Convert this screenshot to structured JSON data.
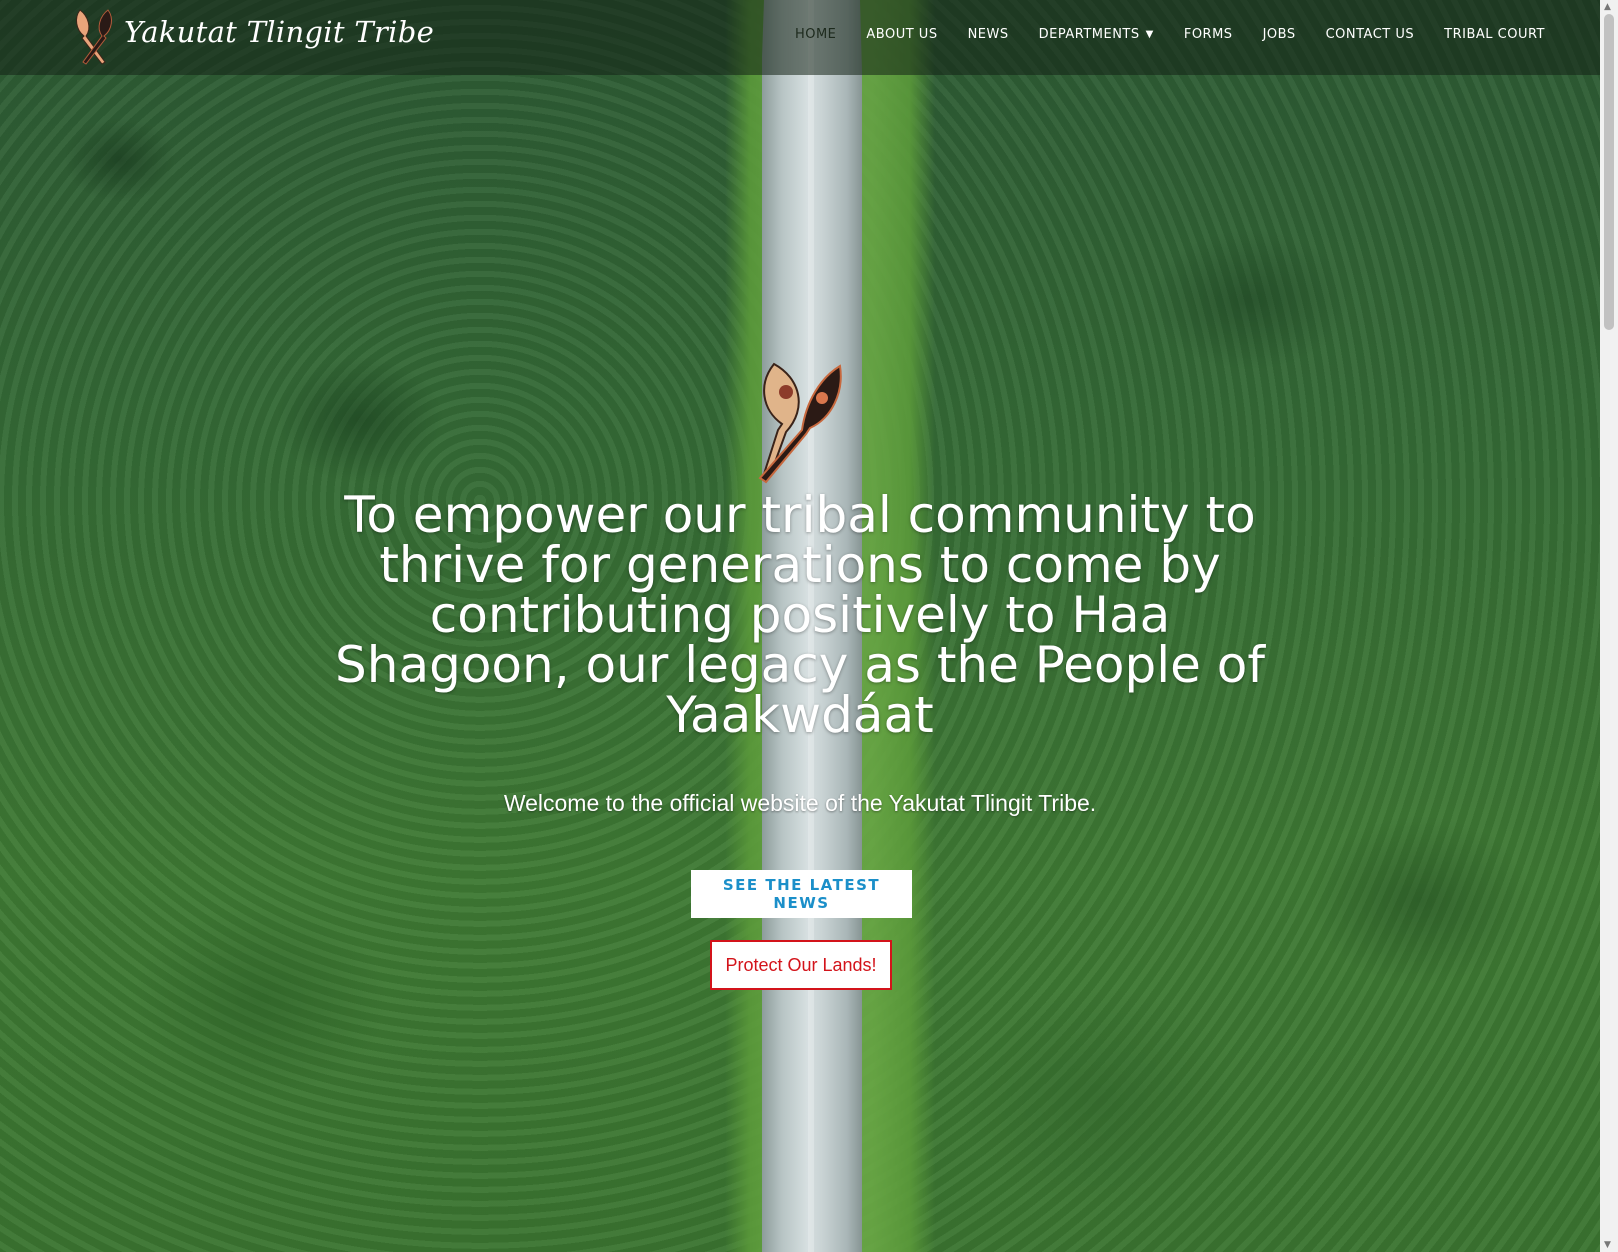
{
  "header": {
    "brand": "Yakutat Tlingit Tribe",
    "nav": [
      {
        "label": "HOME",
        "active": true
      },
      {
        "label": "ABOUT US"
      },
      {
        "label": "NEWS"
      },
      {
        "label": "DEPARTMENTS",
        "has_dropdown": true
      },
      {
        "label": "FORMS"
      },
      {
        "label": "JOBS"
      },
      {
        "label": "CONTACT US"
      },
      {
        "label": "TRIBAL COURT"
      }
    ]
  },
  "hero": {
    "mission": "To empower our tribal community to thrive for generations to come by contributing positively to Haa Shagoon, our legacy as the People of Yaakwdáat",
    "welcome": "Welcome to the official website of the Yakutat Tlingit Tribe.",
    "news_button": "SEE THE LATEST NEWS",
    "lands_button": "Protect Our Lands!"
  },
  "colors": {
    "news_button_text": "#1b8fc9",
    "lands_button": "#d3131a",
    "header_bg": "rgba(20,35,22,.55)"
  },
  "icons": {
    "logo": "crossed-paddles-icon",
    "dropdown": "chevron-down-icon"
  }
}
